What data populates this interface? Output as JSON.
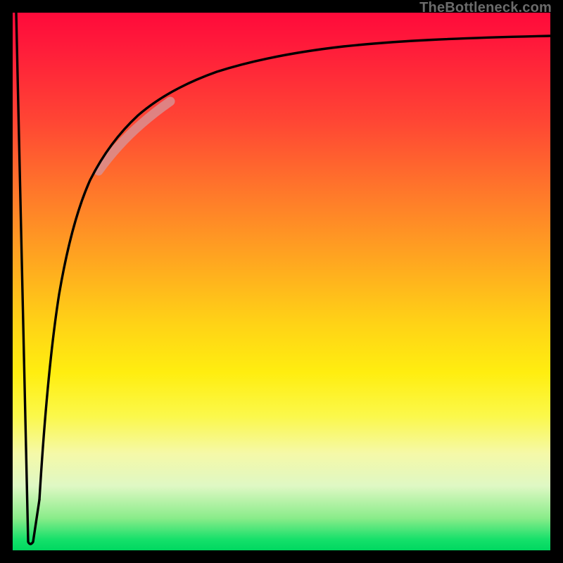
{
  "watermark": "TheBottleneck.com",
  "chart_data": {
    "type": "line",
    "title": "",
    "xlabel": "",
    "ylabel": "",
    "xlim": [
      0,
      100
    ],
    "ylim": [
      0,
      100
    ],
    "grid": false,
    "legend": false,
    "series": [
      {
        "name": "spike-down",
        "x": [
          0.5,
          2.5,
          4.8
        ],
        "y": [
          100,
          1.5,
          1.5
        ]
      },
      {
        "name": "main-curve",
        "x": [
          4.8,
          6,
          8,
          10,
          13,
          16,
          20,
          24,
          28,
          33,
          38,
          44,
          52,
          62,
          76,
          100
        ],
        "y": [
          1.5,
          27,
          45,
          55,
          64,
          70.5,
          76,
          79.8,
          82.6,
          85.2,
          87.2,
          89.0,
          90.6,
          92.1,
          93.3,
          94.4
        ]
      }
    ],
    "highlight_segment": {
      "series": "main-curve",
      "x_range": [
        16,
        28
      ],
      "color_rgba": "rgba(230,150,150,0.78)",
      "stroke_width_px": 12
    },
    "colors": {
      "frame": "#000000",
      "curve": "#000000",
      "gradient_top": "#ff0a3a",
      "gradient_bottom": "#00d860"
    }
  }
}
